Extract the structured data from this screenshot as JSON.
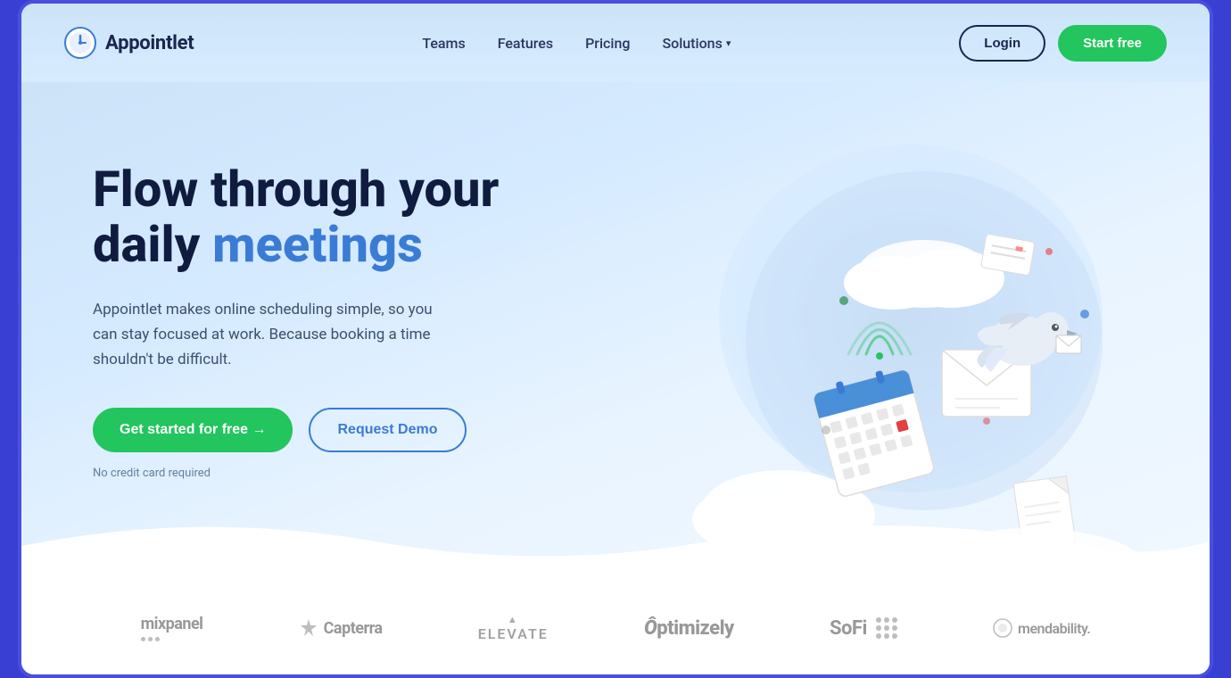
{
  "brand": {
    "logo_text": "Appointlet"
  },
  "nav": {
    "links": [
      {
        "label": "Teams",
        "id": "teams"
      },
      {
        "label": "Features",
        "id": "features"
      },
      {
        "label": "Pricing",
        "id": "pricing"
      },
      {
        "label": "Solutions",
        "id": "solutions"
      }
    ],
    "login_label": "Login",
    "start_free_label": "Start free"
  },
  "hero": {
    "title_line1": "Flow through your",
    "title_line2_normal": "daily ",
    "title_line2_highlight": "meetings",
    "subtitle": "Appointlet makes online scheduling simple, so you can stay focused at work. Because booking a time shouldn't be difficult.",
    "cta_primary": "Get started for free →",
    "cta_secondary": "Request Demo",
    "no_cc_text": "No credit card required"
  },
  "brands": [
    {
      "id": "mixpanel",
      "text": "mixpanel"
    },
    {
      "id": "capterra",
      "text": "Capterra"
    },
    {
      "id": "elevate",
      "text": "ELEVATE"
    },
    {
      "id": "optimizely",
      "text": "Ôptimizely"
    },
    {
      "id": "sofi",
      "text": "SoFi"
    },
    {
      "id": "mendability",
      "text": "mendability."
    }
  ],
  "colors": {
    "accent_green": "#22c55e",
    "accent_blue": "#3a7bd5",
    "dark_navy": "#0f1c40",
    "hero_bg": "#d5eaff"
  }
}
